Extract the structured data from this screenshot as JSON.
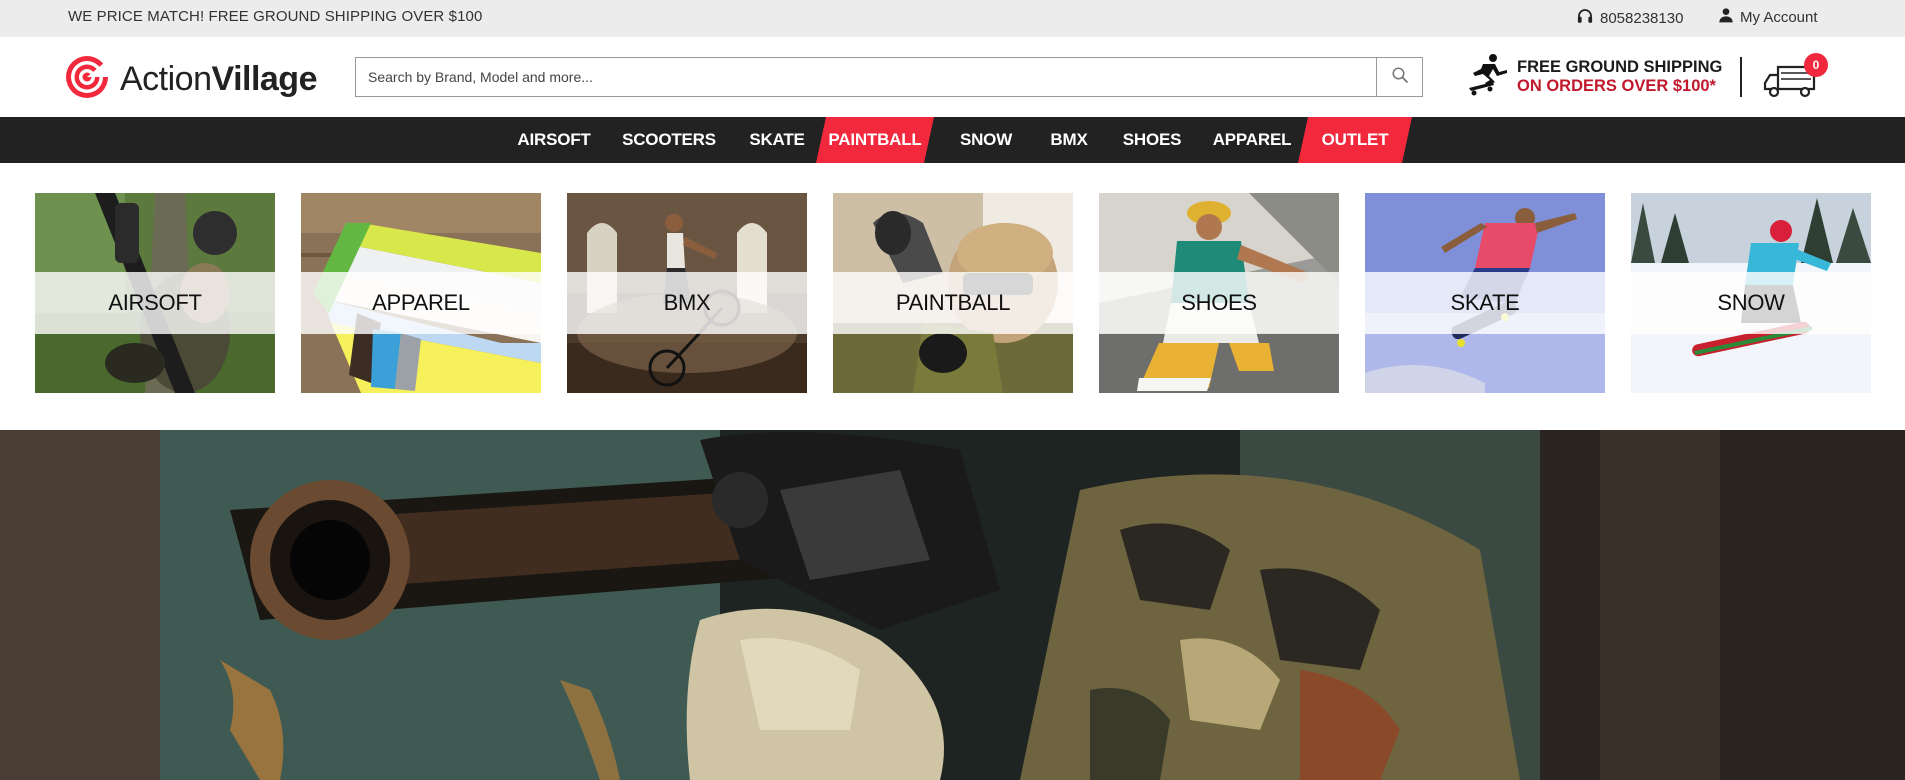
{
  "topbar": {
    "promo": "WE PRICE MATCH! FREE GROUND SHIPPING OVER $100",
    "phone": "8058238130",
    "account": "My Account"
  },
  "header": {
    "logo_light": "Action",
    "logo_bold": "Village",
    "search_placeholder": "Search by Brand, Model and more...",
    "shipping_line1": "FREE GROUND SHIPPING",
    "shipping_line2": "ON ORDERS OVER $100*",
    "cart_count": "0"
  },
  "nav": {
    "items": [
      {
        "label": "AIRSOFT",
        "highlight": false
      },
      {
        "label": "SCOOTERS",
        "highlight": false
      },
      {
        "label": "SKATE",
        "highlight": false
      },
      {
        "label": "PAINTBALL",
        "highlight": true
      },
      {
        "label": "SNOW",
        "highlight": false
      },
      {
        "label": "BMX",
        "highlight": false
      },
      {
        "label": "SHOES",
        "highlight": false
      },
      {
        "label": "APPAREL",
        "highlight": false
      },
      {
        "label": "OUTLET",
        "highlight": true
      }
    ]
  },
  "categories": [
    {
      "label": "AIRSOFT",
      "image": "airsoft-rifle-camo-photo"
    },
    {
      "label": "APPAREL",
      "image": "folded-colorful-tshirts-photo"
    },
    {
      "label": "BMX",
      "image": "bmx-rider-warehouse-photo"
    },
    {
      "label": "PAINTBALL",
      "image": "paintball-player-photo"
    },
    {
      "label": "SHOES",
      "image": "sneakers-jumping-photo"
    },
    {
      "label": "SKATE",
      "image": "skateboarder-air-photo"
    },
    {
      "label": "SNOW",
      "image": "snowboarder-photo"
    }
  ],
  "hero": {
    "image": "paintball-marker-camo-hero-photo"
  },
  "colors": {
    "accent": "#f2283d",
    "nav_bg": "#222222",
    "topbar_bg": "#edecec",
    "shipping_red": "#c0182d"
  }
}
